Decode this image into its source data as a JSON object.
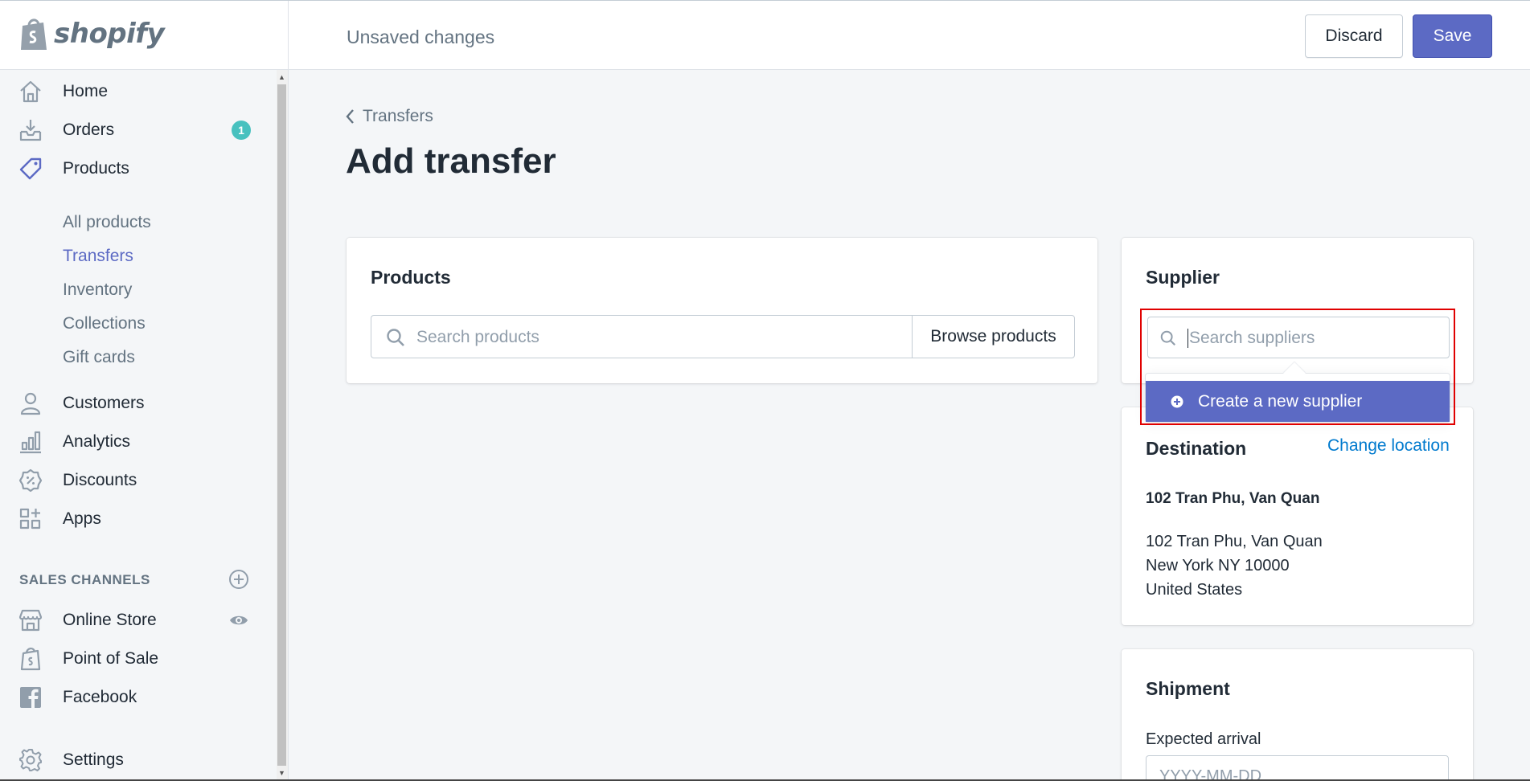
{
  "app": {
    "logo_text": "shopify"
  },
  "header": {
    "status": "Unsaved changes",
    "discard_label": "Discard",
    "save_label": "Save"
  },
  "sidebar": {
    "items": [
      {
        "label": "Home",
        "icon": "home-icon"
      },
      {
        "label": "Orders",
        "icon": "orders-icon",
        "badge": "1"
      },
      {
        "label": "Products",
        "icon": "tag-icon"
      },
      {
        "label": "Customers",
        "icon": "person-icon"
      },
      {
        "label": "Analytics",
        "icon": "bar-chart-icon"
      },
      {
        "label": "Discounts",
        "icon": "discount-icon"
      },
      {
        "label": "Apps",
        "icon": "apps-icon"
      }
    ],
    "product_subitems": [
      "All products",
      "Transfers",
      "Inventory",
      "Collections",
      "Gift cards"
    ],
    "active_subitem": "Transfers",
    "sales_channels_title": "SALES CHANNELS",
    "channels": [
      {
        "label": "Online Store",
        "icon": "store-icon"
      },
      {
        "label": "Point of Sale",
        "icon": "pos-icon"
      },
      {
        "label": "Facebook",
        "icon": "facebook-icon"
      }
    ],
    "settings_label": "Settings"
  },
  "main": {
    "breadcrumb": "Transfers",
    "title": "Add transfer",
    "products_card": {
      "title": "Products",
      "search_placeholder": "Search products",
      "browse_label": "Browse products"
    },
    "supplier_card": {
      "title": "Supplier",
      "search_placeholder": "Search suppliers",
      "create_label": "Create a new supplier"
    },
    "destination_card": {
      "title": "Destination",
      "change_label": "Change location",
      "name": "102 Tran Phu, Van Quan",
      "address_lines": [
        "102 Tran Phu, Van Quan",
        "New York NY 10000",
        "United States"
      ]
    },
    "shipment_card": {
      "title": "Shipment",
      "expected_label": "Expected arrival",
      "date_placeholder": "YYYY-MM-DD"
    }
  },
  "colors": {
    "accent": "#5c6ac4",
    "link": "#007ace",
    "badge": "#47c1bf",
    "highlight": "#e00000"
  }
}
